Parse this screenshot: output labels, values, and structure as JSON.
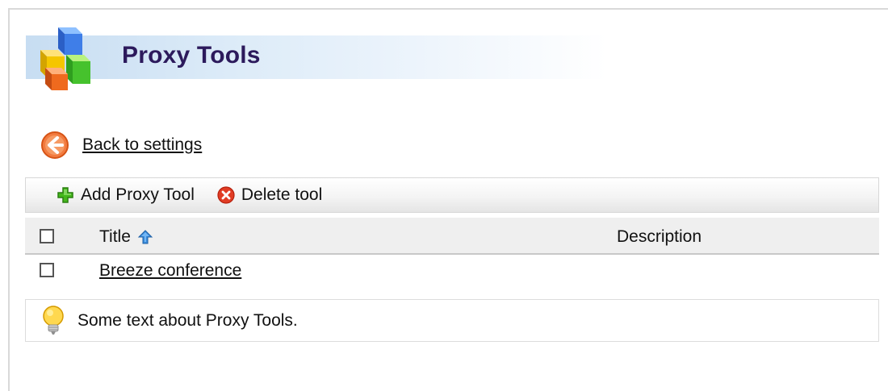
{
  "page": {
    "title": "Proxy Tools",
    "back_label": "Back to settings"
  },
  "toolbar": {
    "add_label": "Add Proxy Tool",
    "delete_label": "Delete tool"
  },
  "table": {
    "columns": [
      "Title",
      "Description"
    ],
    "sort": {
      "column": "Title",
      "direction": "ascending"
    },
    "rows": [
      {
        "title": "Breeze conference",
        "description": ""
      }
    ]
  },
  "info": {
    "text": "Some text about Proxy Tools."
  },
  "icons": {
    "header": "cubes-icon",
    "back": "back-arrow-icon",
    "add": "green-plus-icon",
    "delete": "red-x-icon",
    "sort": "sort-ascending-arrow-icon",
    "info": "lightbulb-icon"
  },
  "colors": {
    "title": "#2c1a5c",
    "header_band": "#c7ddf2",
    "toolbar_bg": "#f4f4f4",
    "grid_header_bg": "#efefef"
  }
}
